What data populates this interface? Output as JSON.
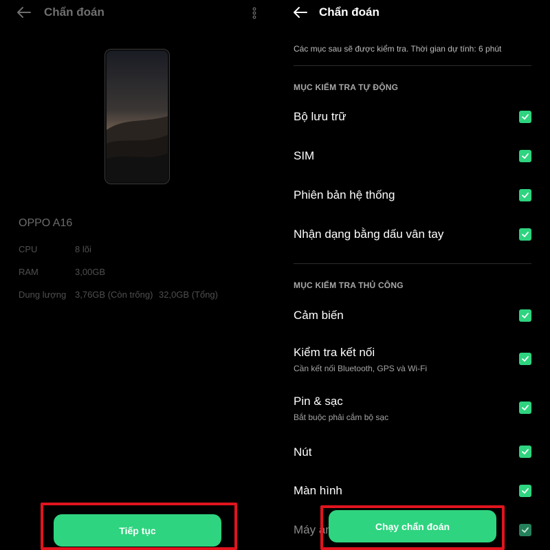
{
  "left_screen": {
    "title": "Chẩn đoán",
    "device_name": "OPPO A16",
    "specs": [
      {
        "label": "CPU",
        "value": "8 lõi"
      },
      {
        "label": "RAM",
        "value": "3,00GB"
      },
      {
        "label": "Dung lượng",
        "value": "3,76GB (Còn trống)",
        "extra": "32,0GB (Tổng)"
      }
    ],
    "continue_button": "Tiếp tục"
  },
  "right_screen": {
    "title": "Chẩn đoán",
    "description": "Các mục sau sẽ được kiểm tra. Thời gian dự tính: 6 phút",
    "auto_section": {
      "header": "MỤC KIỂM TRA TỰ ĐỘNG",
      "items": [
        {
          "label": "Bộ lưu trữ",
          "checked": true
        },
        {
          "label": "SIM",
          "checked": true
        },
        {
          "label": "Phiên bản hệ thống",
          "checked": true
        },
        {
          "label": "Nhận dạng bằng dấu vân tay",
          "checked": true
        }
      ]
    },
    "manual_section": {
      "header": "MỤC KIỂM TRA THỦ CÔNG",
      "items": [
        {
          "label": "Cảm biến",
          "sub": "",
          "checked": true
        },
        {
          "label": "Kiểm tra kết nối",
          "sub": "Cần kết nối Bluetooth, GPS và Wi-Fi",
          "checked": true
        },
        {
          "label": "Pin & sạc",
          "sub": "Bắt buộc phải cắm bộ sạc",
          "checked": true
        },
        {
          "label": "Nút",
          "sub": "",
          "checked": true
        },
        {
          "label": "Màn hình",
          "sub": "",
          "checked": true
        },
        {
          "label": "Máy ảnh",
          "sub": "",
          "checked": true
        }
      ]
    },
    "run_button": "Chạy chẩn đoán"
  },
  "colors": {
    "accent": "#2ed47f",
    "highlight": "#e0141e",
    "background": "#000000"
  },
  "icons": [
    "back-arrow-icon",
    "more-vertical-icon",
    "checkbox-checked-icon"
  ]
}
